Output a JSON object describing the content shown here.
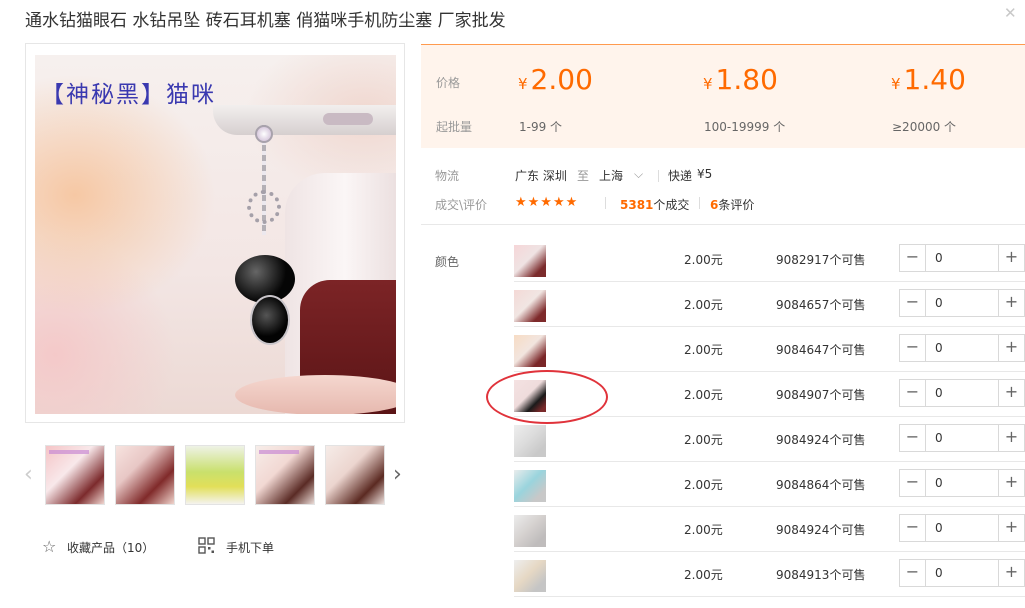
{
  "product": {
    "title": "通水钻猫眼石 水钻吊坠 砖石耳机塞 俏猫咪手机防尘塞 厂家批发",
    "image_caption": "【神秘黑】猫咪"
  },
  "gallery": {
    "prev_icon": "chevron-left-icon",
    "next_icon": "chevron-right-icon",
    "thumb_count": 5
  },
  "actions": {
    "favorite_label": "收藏产品（10）",
    "mobile_order_label": "手机下单"
  },
  "price": {
    "price_label": "价格",
    "moq_label": "起批量",
    "currency": "¥",
    "tiers": [
      {
        "amount": "2.00",
        "range": "1-99 个"
      },
      {
        "amount": "1.80",
        "range": "100-19999 个"
      },
      {
        "amount": "1.40",
        "range": "≥20000 个"
      }
    ]
  },
  "logistics": {
    "label": "物流",
    "from": "广东 深圳",
    "to_word": "至",
    "to": "上海",
    "express": "快递",
    "fee": "¥5"
  },
  "deals": {
    "label": "成交\\评价",
    "stars": "★★★★★",
    "sales_count": "5381",
    "sales_suffix": "个成交",
    "review_count": "6",
    "review_suffix": "条评价"
  },
  "sku": {
    "label": "颜色",
    "rows": [
      {
        "price": "2.00元",
        "stock": "9082917个可售",
        "qty": "0"
      },
      {
        "price": "2.00元",
        "stock": "9084657个可售",
        "qty": "0"
      },
      {
        "price": "2.00元",
        "stock": "9084647个可售",
        "qty": "0"
      },
      {
        "price": "2.00元",
        "stock": "9084907个可售",
        "qty": "0"
      },
      {
        "price": "2.00元",
        "stock": "9084924个可售",
        "qty": "0"
      },
      {
        "price": "2.00元",
        "stock": "9084864个可售",
        "qty": "0"
      },
      {
        "price": "2.00元",
        "stock": "9084924个可售",
        "qty": "0"
      },
      {
        "price": "2.00元",
        "stock": "9084913个可售",
        "qty": "0"
      }
    ]
  },
  "colors": {
    "accent": "#ff6a00",
    "price_bg": "#fff4ec",
    "annotation": "#e0333b"
  }
}
